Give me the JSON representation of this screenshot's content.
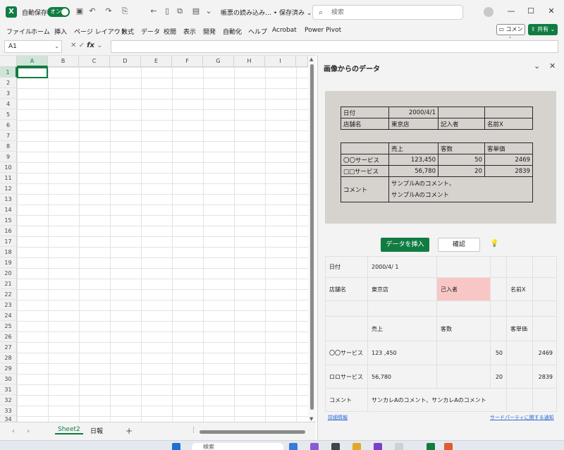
{
  "titlebar": {
    "autosave_label": "自動保存",
    "toggle_label": "オン",
    "doc_title": "帳票の読み込み… • 保存済み ⌄",
    "search_placeholder": "検索"
  },
  "ribbon": {
    "tabs": [
      "ファイル",
      "ホーム",
      "挿入",
      "ページ レイアウト",
      "数式",
      "データ",
      "校閲",
      "表示",
      "開発",
      "自動化",
      "ヘルプ",
      "Acrobat",
      "Power Pivot"
    ],
    "comment_label": "コメント",
    "share_label": "共有"
  },
  "formula_bar": {
    "name_box": "A1",
    "fx": "fx",
    "formula": ""
  },
  "grid": {
    "columns": [
      "A",
      "B",
      "C",
      "D",
      "E",
      "F",
      "G",
      "H",
      "I"
    ],
    "rows": [
      "1",
      "2",
      "3",
      "4",
      "5",
      "6",
      "7",
      "8",
      "9",
      "10",
      "11",
      "12",
      "13",
      "14",
      "15",
      "16",
      "17",
      "18",
      "19",
      "20",
      "21",
      "22",
      "23",
      "24",
      "25",
      "26",
      "27",
      "28",
      "29",
      "30",
      "31",
      "32",
      "33",
      "34"
    ],
    "selected_cell": "A1"
  },
  "sheets": {
    "tabs": [
      "Sheet2",
      "日報"
    ],
    "active": "Sheet2"
  },
  "panel": {
    "title": "画像からのデータ",
    "photo": {
      "row1": [
        "日付",
        "2000/4/1",
        "",
        ""
      ],
      "row2": [
        "店舗名",
        "東京店",
        "記入者",
        "名前X"
      ],
      "header": [
        "",
        "売上",
        "客数",
        "客単価"
      ],
      "row3": [
        "〇〇サービス",
        "123,450",
        "50",
        "2469"
      ],
      "row4": [
        "□□サービス",
        "56,780",
        "20",
        "2839"
      ],
      "comment_label": "コメント",
      "comment_line1": "サンプルAのコメント、",
      "comment_line2": "サンプルAのコメント"
    },
    "insert_button": "データを挿入",
    "confirm_button": "確認",
    "result": {
      "date_label": "日付",
      "date_value": "2000/4/ 1",
      "store_label": "店舗名",
      "store_value": "東京店",
      "writer_label": "己入者",
      "writer_value": "名前X",
      "sales_header": "売上",
      "customers_header": "客数",
      "unit_price_header": "客単価",
      "svc1_label": "〇〇サービス",
      "svc1_sales": "123 ,450",
      "svc1_customers": "50",
      "svc1_unit_price": "2469",
      "svc2_label": "ロロサービス",
      "svc2_sales": "56,780",
      "svc2_customers": "20",
      "svc2_unit_price": "2839",
      "comment_label": "コメント",
      "comment_value": "サンカレAのコメント、サンカレAのコメント"
    },
    "detail_link": "詳細情報",
    "third_party_link": "サードパーティに関する通知"
  },
  "taskbar": {
    "search_label": "検索"
  },
  "colors": {
    "excel_green": "#107c41",
    "highlight_pink": "#f9c6c6"
  }
}
